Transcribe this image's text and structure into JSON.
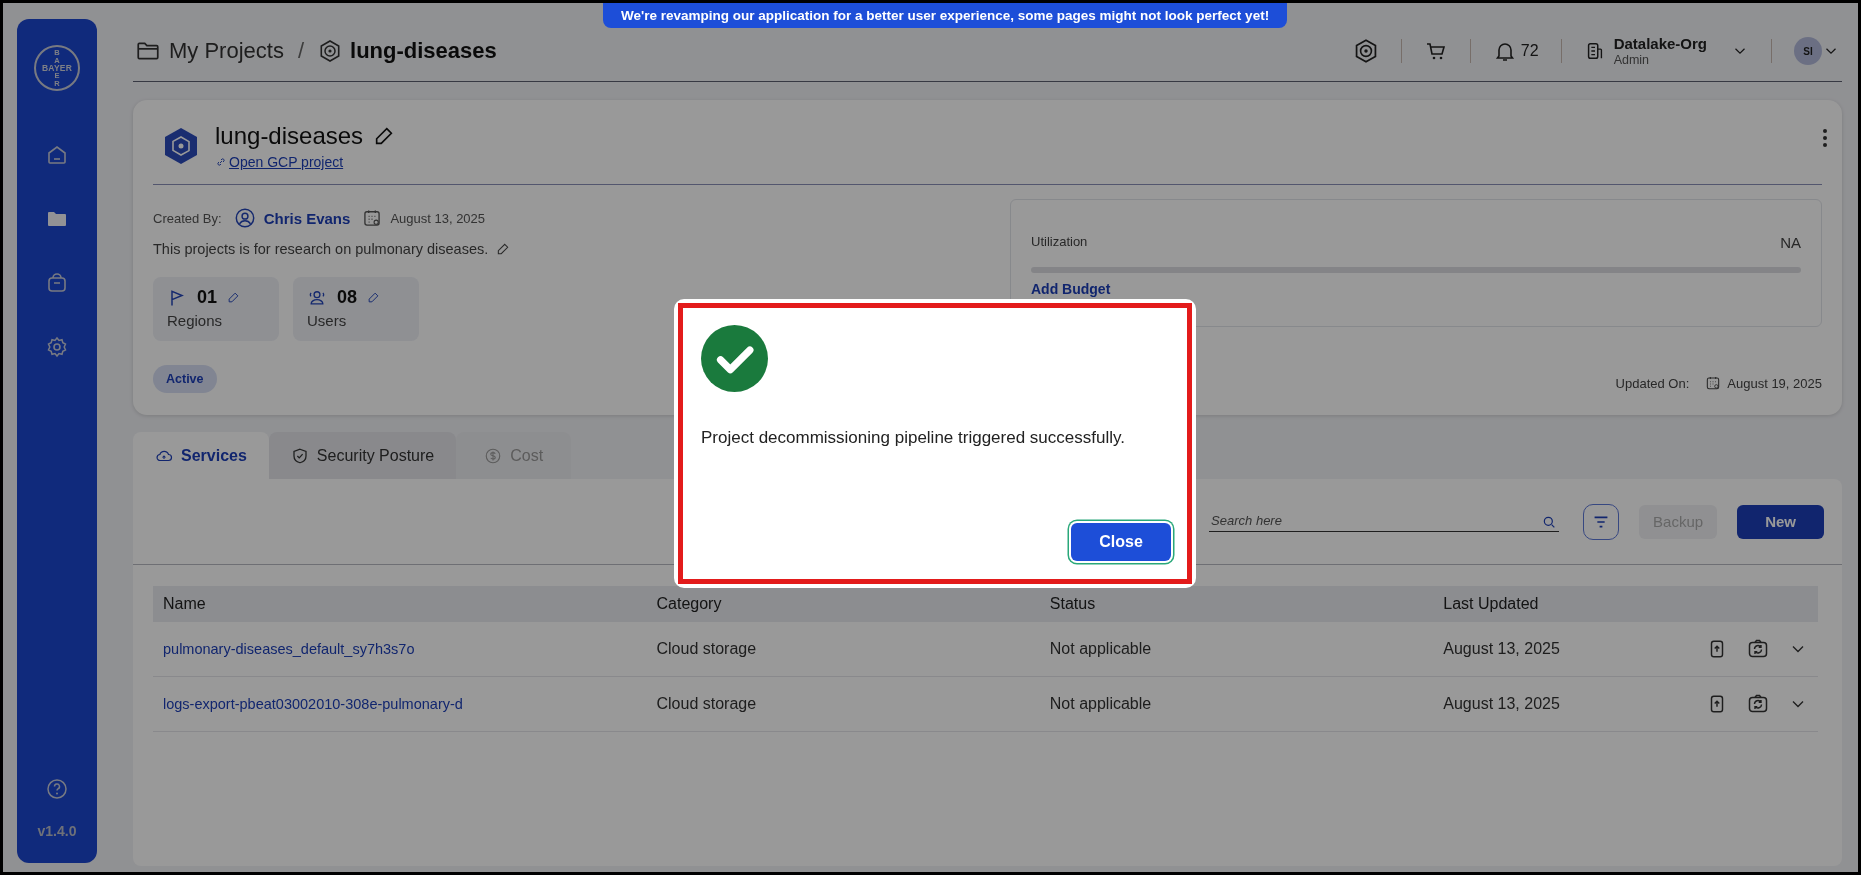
{
  "banner": "We're revamping our application for a better user experience, some pages might not look perfect yet!",
  "sidebar": {
    "logo": {
      "horizontal": "BAYER",
      "vertical_top": "BA",
      "vertical_bottom": "ER"
    },
    "nav": [
      {
        "selected": false
      },
      {
        "selected": true
      },
      {
        "selected": false
      },
      {
        "selected": false
      }
    ],
    "version": "v1.4.0"
  },
  "header": {
    "breadcrumb": [
      "My Projects",
      "lung-diseases"
    ],
    "separator": "/",
    "notifications": "72",
    "org": "Datalake-Org",
    "role": "Admin",
    "avatar": "SI"
  },
  "project": {
    "name": "lung-diseases",
    "link": "Open GCP project",
    "created_by_label": "Created By:",
    "creator": "Chris Evans",
    "created_date": "August 13, 2025",
    "description": "This projects is for research on pulmonary diseases.",
    "stats": [
      {
        "value": "01",
        "label": "Regions"
      },
      {
        "value": "08",
        "label": "Users"
      }
    ],
    "status": "Active",
    "budget": {
      "label": "Utilization",
      "value": "NA",
      "level": 0,
      "link": "Add Budget"
    },
    "updated_label": "Updated On:",
    "updated_date": "August 19, 2025"
  },
  "tabs": [
    {
      "label": "Services",
      "selected": true,
      "disabled": false
    },
    {
      "label": "Security Posture",
      "selected": false,
      "disabled": false
    },
    {
      "label": "Cost",
      "selected": false,
      "disabled": true
    }
  ],
  "toolbar": {
    "search": {
      "placeholder": "Search here"
    },
    "buttons": [
      {
        "label": "Backup",
        "disabled": true
      },
      {
        "label": "New",
        "disabled": false
      }
    ]
  },
  "table": {
    "columns": [
      "Name",
      "Category",
      "Status",
      "Last Updated"
    ],
    "rows": [
      [
        "pulmonary-diseases_default_sy7h3s7o",
        "Cloud storage",
        "Not applicable",
        "August 13, 2025"
      ],
      [
        "logs-export-pbeat03002010-308e-pulmonary-d",
        "Cloud storage",
        "Not applicable",
        "August 13, 2025"
      ]
    ]
  },
  "modal": {
    "kind": "success",
    "message": "Project decommissioning pipeline triggered successfully.",
    "button": "Close"
  }
}
